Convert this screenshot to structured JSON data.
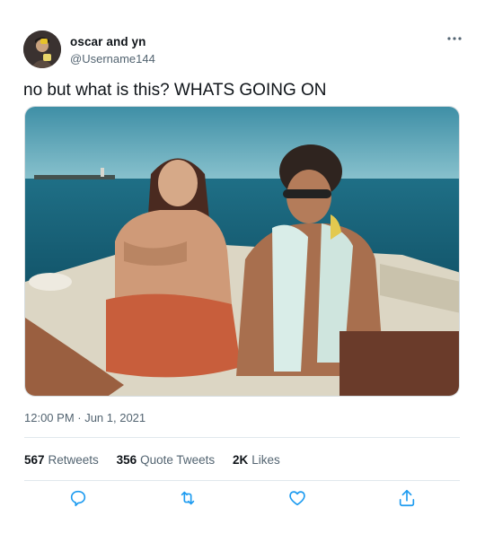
{
  "user": {
    "display_name": "oscar and yn",
    "handle": "@Username144"
  },
  "tweet": {
    "text": "no but what is this? WHATS GOING ON",
    "timestamp": "12:00 PM · Jun 1, 2021"
  },
  "stats": [
    {
      "count": "567",
      "label": "Retweets"
    },
    {
      "count": "356",
      "label": "Quote Tweets"
    },
    {
      "count": "2K",
      "label": "Likes"
    }
  ],
  "icons": {
    "more": "more-options-icon",
    "reply": "reply-icon",
    "retweet": "retweet-icon",
    "like": "like-icon",
    "share": "share-icon"
  },
  "colors": {
    "text": "#0f1419",
    "secondary": "#536471",
    "icon": "#1d9bf0",
    "divider": "#e1e8ed"
  }
}
